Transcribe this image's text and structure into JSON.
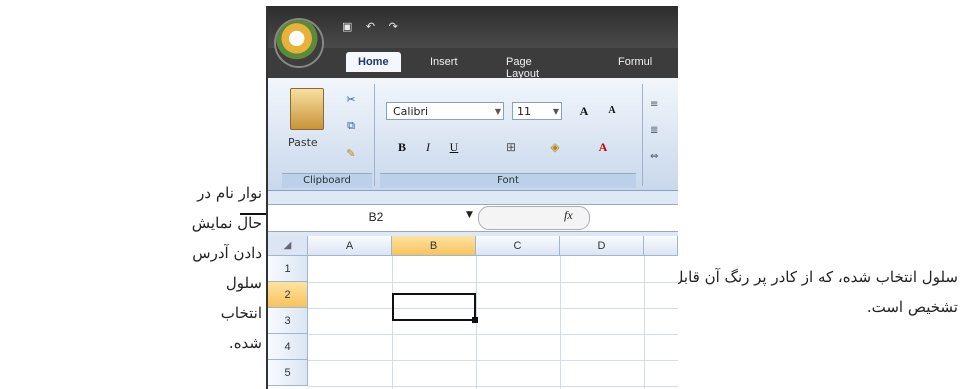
{
  "captions": {
    "left": "نوار نام در حال نمایش دادن آدرس سلول انتخاب شده.",
    "right": "سلول انتخاب شده، که از کادر پر رنگ آن قابل تشخیص است."
  },
  "ribbon": {
    "tabs": [
      "Home",
      "Insert",
      "Page Layout",
      "Formul"
    ],
    "active_tab": "Home",
    "clipboard": {
      "paste_label": "Paste",
      "group_label": "Clipboard"
    },
    "font": {
      "group_label": "Font",
      "font_name": "Calibri",
      "font_size": "11",
      "grow": "A",
      "shrink": "A",
      "bold": "B",
      "italic": "I",
      "underline": "U",
      "font_color": "A"
    }
  },
  "formula_bar": {
    "name_box": "B2",
    "fx_label": "fx"
  },
  "sheet": {
    "columns": [
      "A",
      "B",
      "C",
      "D"
    ],
    "rows": [
      "1",
      "2",
      "3",
      "4",
      "5"
    ],
    "selected_cell": "B2"
  },
  "colors": {
    "accent": "#f7c35c",
    "ribbon": "#dfe8f5",
    "title_bar": "#2d2d2d"
  }
}
